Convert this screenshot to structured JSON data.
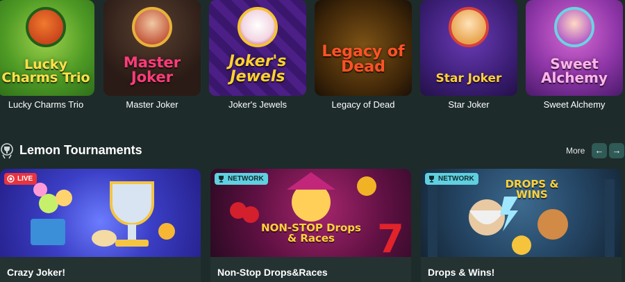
{
  "games": [
    {
      "title": "Lucky Charms Trio",
      "logo": "Lucky Charms Trio"
    },
    {
      "title": "Master Joker",
      "logo": "Master Joker"
    },
    {
      "title": "Joker's Jewels",
      "logo": "Joker's Jewels"
    },
    {
      "title": "Legacy of Dead",
      "logo": "Legacy of Dead"
    },
    {
      "title": "Star Joker",
      "logo": "Star Joker"
    },
    {
      "title": "Sweet Alchemy",
      "logo": "Sweet Alchemy"
    }
  ],
  "section": {
    "icon": "trophy-icon",
    "title": "Lemon Tournaments",
    "more_label": "More",
    "prev_icon": "arrow-left-icon",
    "next_icon": "arrow-right-icon"
  },
  "tournaments": [
    {
      "name": "Crazy Joker!",
      "badge": "LIVE",
      "badge_icon": "live-icon",
      "badge_color": "#e8343f"
    },
    {
      "name": "Non-Stop Drops&Races",
      "badge": "NETWORK",
      "badge_icon": "trophy-icon",
      "badge_color": "#5fd0e0",
      "art_text": "NON-STOP Drops & Races"
    },
    {
      "name": "Drops & Wins!",
      "badge": "NETWORK",
      "badge_icon": "trophy-icon",
      "badge_color": "#5fd0e0",
      "art_text": "DROPS & WINS"
    }
  ],
  "colors": {
    "background": "#1e2b2b",
    "nav_button": "#2f5a55",
    "text": "#ffffff"
  }
}
